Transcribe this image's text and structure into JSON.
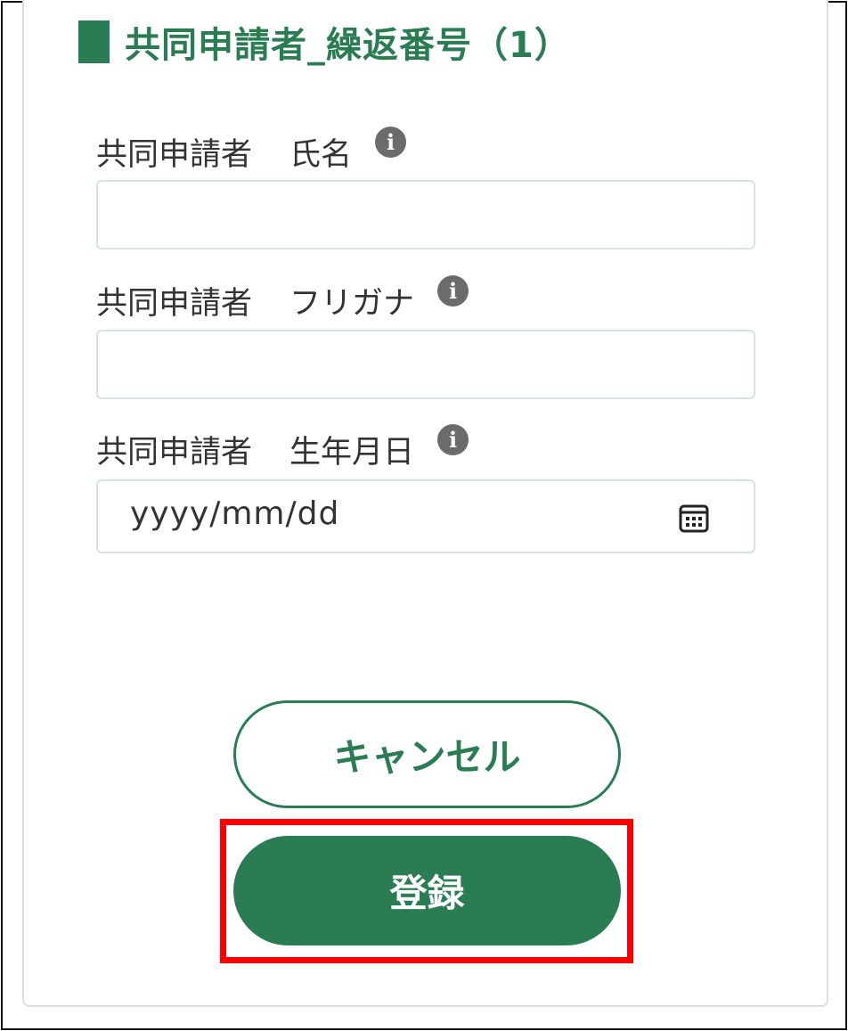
{
  "section": {
    "title": "共同申請者_繰返番号（1）"
  },
  "fields": [
    {
      "label_main": "共同申請者",
      "label_sub": "氏名",
      "info_icon": "info-icon",
      "value": ""
    },
    {
      "label_main": "共同申請者",
      "label_sub": "フリガナ",
      "info_icon": "info-icon",
      "value": ""
    },
    {
      "label_main": "共同申請者",
      "label_sub": "生年月日",
      "info_icon": "info-icon",
      "placeholder": "yyyy/mm/dd",
      "trailing_icon": "calendar-icon"
    }
  ],
  "info_glyph": "i",
  "buttons": {
    "cancel_label": "キャンセル",
    "register_label": "登録"
  },
  "colors": {
    "accent": "#2a7d53",
    "highlight": "#ff0000",
    "info_icon": "#6b6b6b",
    "input_border": "#d7e3dd"
  }
}
